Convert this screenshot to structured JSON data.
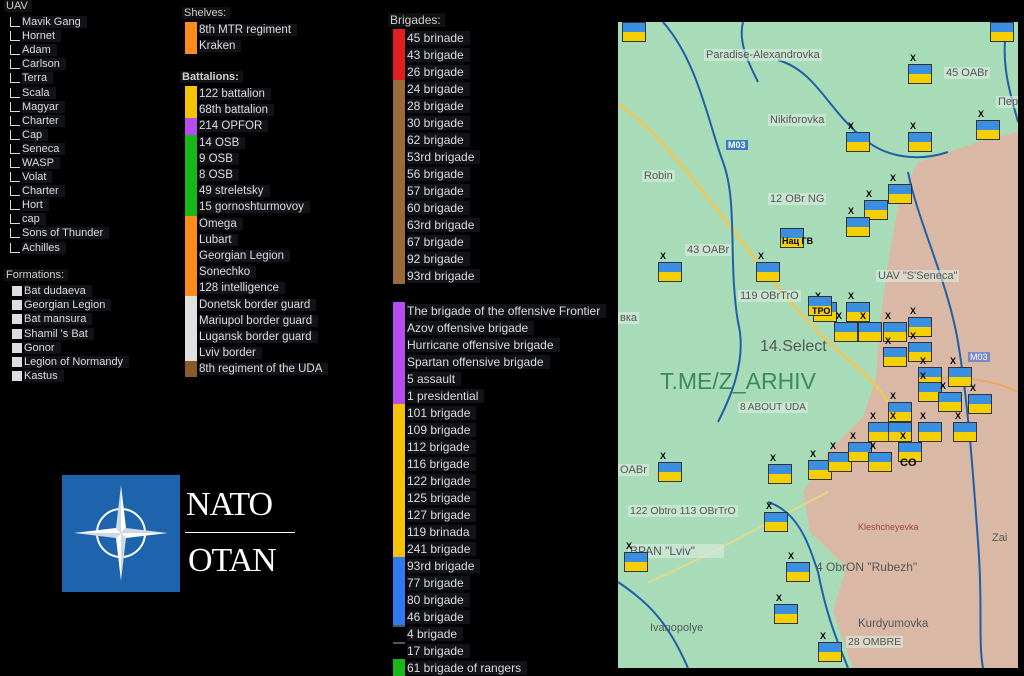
{
  "uav": {
    "header": "UAV",
    "items": [
      "Mavik Gang",
      "Hornet",
      "Adam",
      "Carlson",
      "Terra",
      "Scala",
      "Magyar",
      "Charter",
      "Cap",
      "Seneca",
      "WASP",
      "Volat",
      "Charter",
      "Hort",
      "cap",
      "Sons of Thunder",
      "Achilles"
    ]
  },
  "formations": {
    "header": "Formations:",
    "items": [
      "Bat dudaeva",
      "Georgian Legion",
      "Bat mansura",
      "Shamil 's Bat",
      "Gonor",
      "Legion of Normandy",
      "Kastus"
    ]
  },
  "shelves": {
    "header": "Shelves:",
    "items": [
      {
        "label": "8th MTR regiment",
        "color": "#ff8c1a"
      },
      {
        "label": "Kraken",
        "color": "#ff8c1a"
      }
    ]
  },
  "battalions": {
    "header": "Battalions:",
    "items": [
      {
        "label": "122 battalion",
        "color": "#f5c400"
      },
      {
        "label": "68th battalion",
        "color": "#f5c400"
      },
      {
        "label": "214 OPFOR",
        "color": "#b84cf0"
      },
      {
        "label": "14 OSB",
        "color": "#18b818"
      },
      {
        "label": "9 OSB",
        "color": "#18b818"
      },
      {
        "label": "8 OSB",
        "color": "#18b818"
      },
      {
        "label": "49 streletsky",
        "color": "#18b818"
      },
      {
        "label": "15 gornoshturmovoy",
        "color": "#18b818"
      },
      {
        "label": "Omega",
        "color": "#ff8c1a"
      },
      {
        "label": "Lubart",
        "color": "#ff8c1a"
      },
      {
        "label": "Georgian Legion",
        "color": "#ff8c1a"
      },
      {
        "label": "Sonechko",
        "color": "#ff8c1a"
      },
      {
        "label": "128 intelligence",
        "color": "#ff8c1a"
      },
      {
        "label": "Donetsk border guard",
        "color": "#e0e0e0"
      },
      {
        "label": "Mariupol border guard",
        "color": "#e0e0e0"
      },
      {
        "label": "Lugansk border guard",
        "color": "#e0e0e0"
      },
      {
        "label": "Lviv border",
        "color": "#e0e0e0"
      },
      {
        "label": "8th regiment of the UDA",
        "color": "#8b5a2b"
      }
    ]
  },
  "brigades": {
    "header": "Brigades:",
    "items": [
      {
        "label": "45 brinade",
        "color": "#e02020"
      },
      {
        "label": "43 brigade",
        "color": "#e02020"
      },
      {
        "label": "26 brigade",
        "color": "#e02020"
      },
      {
        "label": "24 brigade",
        "color": "#9a6a3a"
      },
      {
        "label": "28 brigade",
        "color": "#9a6a3a"
      },
      {
        "label": "30 brigade",
        "color": "#9a6a3a"
      },
      {
        "label": "62 brigade",
        "color": "#9a6a3a"
      },
      {
        "label": "53rd brigade",
        "color": "#9a6a3a"
      },
      {
        "label": "56 brigade",
        "color": "#9a6a3a"
      },
      {
        "label": "57 brigade",
        "color": "#9a6a3a"
      },
      {
        "label": "60 brigade",
        "color": "#9a6a3a"
      },
      {
        "label": "63rd brigade",
        "color": "#9a6a3a"
      },
      {
        "label": "67 brigade",
        "color": "#9a6a3a"
      },
      {
        "label": "92 brigade",
        "color": "#9a6a3a"
      },
      {
        "label": "93rd brigade",
        "color": "#9a6a3a"
      }
    ],
    "items2": [
      {
        "label": "The brigade of the offensive Frontier",
        "color": "#b84cf0"
      },
      {
        "label": "Azov offensive brigade",
        "color": "#b84cf0"
      },
      {
        "label": "Hurricane offensive brigade",
        "color": "#b84cf0"
      },
      {
        "label": "Spartan offensive brigade",
        "color": "#b84cf0"
      },
      {
        "label": "5 assault",
        "color": "#b84cf0"
      },
      {
        "label": "1 presidential",
        "color": "#b84cf0"
      },
      {
        "label": "101 brigade",
        "color": "#f5c400"
      },
      {
        "label": "109 brigade",
        "color": "#f5c400"
      },
      {
        "label": "112 brigade",
        "color": "#f5c400"
      },
      {
        "label": "116 brigade",
        "color": "#f5c400"
      },
      {
        "label": "122 brigade",
        "color": "#f5c400"
      },
      {
        "label": "125 brigade",
        "color": "#f5c400"
      },
      {
        "label": "127 brigade",
        "color": "#f5c400"
      },
      {
        "label": "119 brinada",
        "color": "#f5c400"
      },
      {
        "label": "241 brigade",
        "color": "#f5c400"
      },
      {
        "label": "93rd brigade",
        "color": "#2f7af0"
      },
      {
        "label": "77 brigade",
        "color": "#2f7af0"
      },
      {
        "label": "80 brigade",
        "color": "#2f7af0"
      },
      {
        "label": "46 brigade",
        "color": "#2f7af0"
      },
      {
        "label": "4 brigade",
        "color": "#555555"
      },
      {
        "label": "17 brigade",
        "color": "#555555"
      },
      {
        "label": "61 brigade of rangers",
        "color": "#18b818"
      }
    ]
  },
  "logo": {
    "line1": "NATO",
    "line2": "OTAN"
  },
  "map": {
    "labels": {
      "paradise": "Paradise-Alexandrovka",
      "oabr45": "45 OABr",
      "per": "Пер",
      "nikiforovka": "Nikiforovka",
      "m03": "M03",
      "robin": "Robin",
      "ng12": "12 OBr NG",
      "oabr43": "43 OABr",
      "uav_seneca": "UAV \"S'Seneca\"",
      "obrtro119": "119 OBrTrO",
      "vka": "вка",
      "select14": "14.Select",
      "watermark": "T.ME/Z_ARHIV",
      "uda8": "8 ABOUT UDA",
      "m03b": "M03",
      "oabr": "OABr",
      "obrtro122": "122 Obtro 113 OBrTrO",
      "kleshcheyevka": "Kleshcheyevka",
      "zai": "Zai",
      "bpan": "BPAN \"Lviv\"",
      "rubezh": "4 ObrON \"Rubezh\"",
      "ivanopolye": "Ivanopolye",
      "kurdyumovka": "Kurdyumovka",
      "ombre28": "28 OMBRE",
      "natsgv": "Нац ГВ",
      "tpo": "ТРО",
      "co": "CO"
    }
  }
}
